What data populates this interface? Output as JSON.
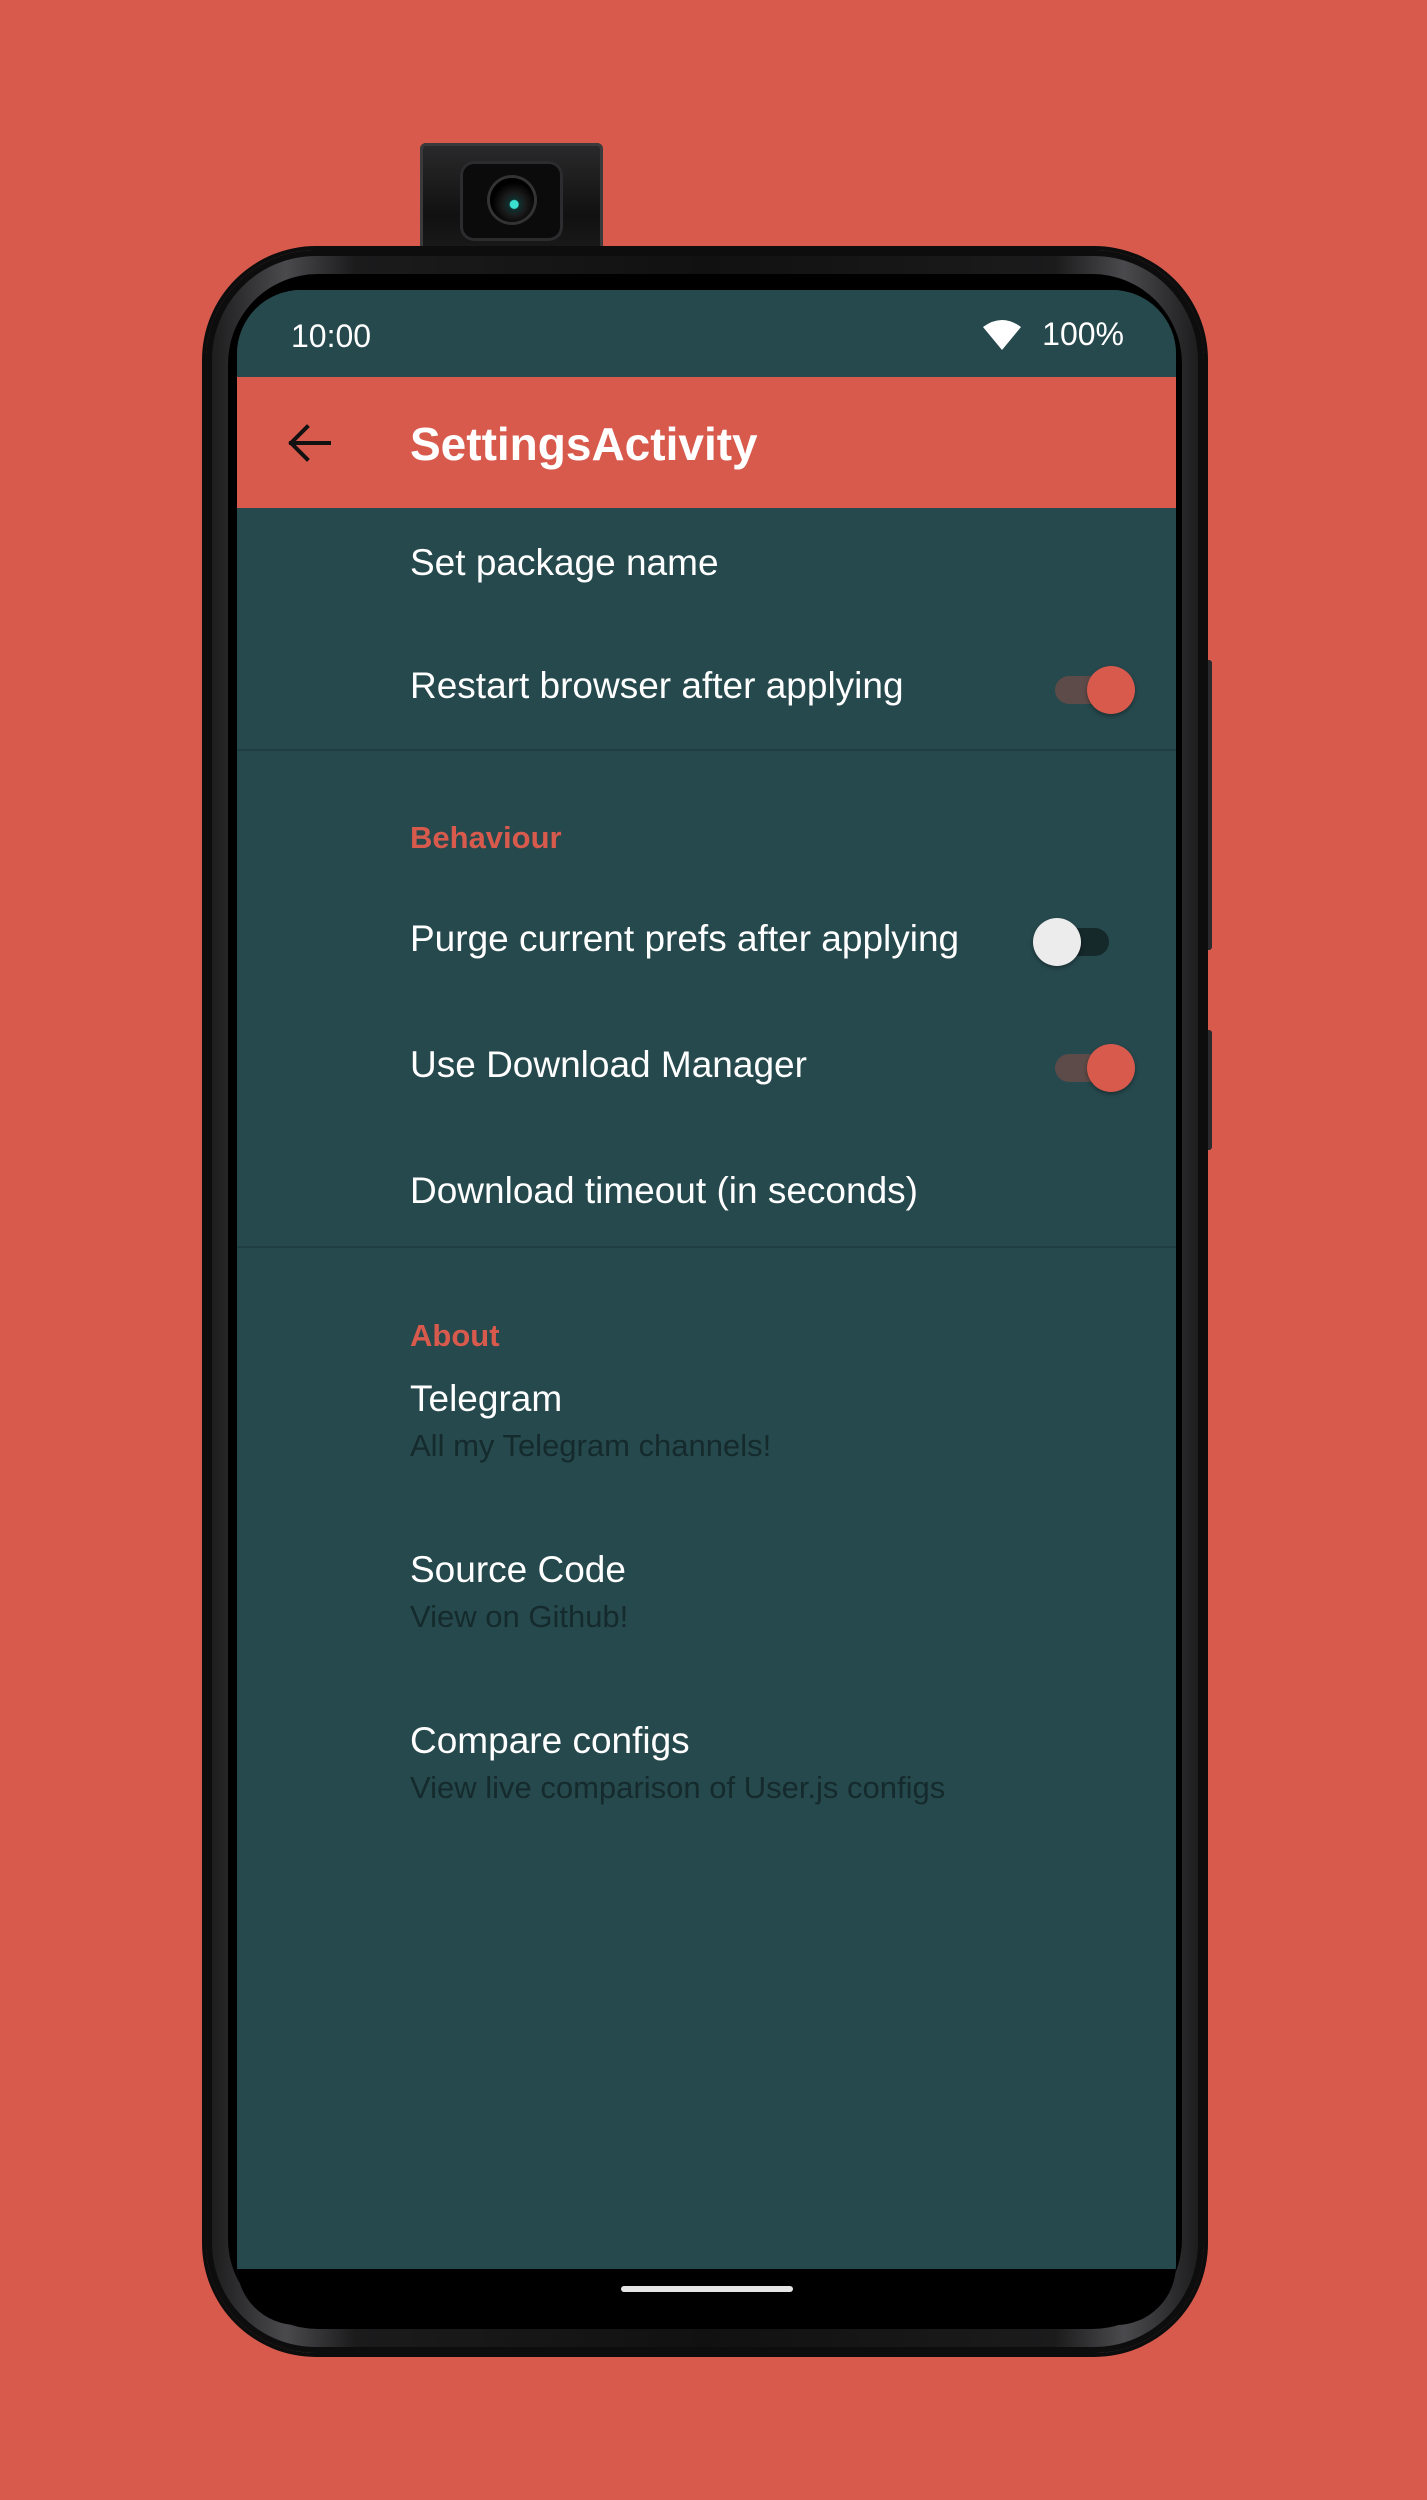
{
  "status_bar": {
    "time": "10:00",
    "battery": "100%"
  },
  "app_bar": {
    "title": "SettingsActivity"
  },
  "general": {
    "set_package_name": "Set package name",
    "restart_browser": {
      "label": "Restart browser after applying",
      "enabled": true
    }
  },
  "behaviour": {
    "header": "Behaviour",
    "purge_prefs": {
      "label": "Purge current prefs after applying",
      "enabled": false
    },
    "download_manager": {
      "label": "Use Download Manager",
      "enabled": true
    },
    "download_timeout": "Download timeout (in seconds)"
  },
  "about": {
    "header": "About",
    "items": [
      {
        "title": "Telegram",
        "summary": "All my Telegram channels!"
      },
      {
        "title": "Source Code",
        "summary": "View on Github!"
      },
      {
        "title": "Compare configs",
        "summary": "View live comparison of User.js configs"
      }
    ]
  },
  "colors": {
    "background": "#d85a4d",
    "accent": "#d85a4d",
    "surface": "#26494d",
    "summary_text": "#152a2c"
  },
  "icons": {
    "back": "arrow-left-icon",
    "wifi": "wifi-icon"
  }
}
